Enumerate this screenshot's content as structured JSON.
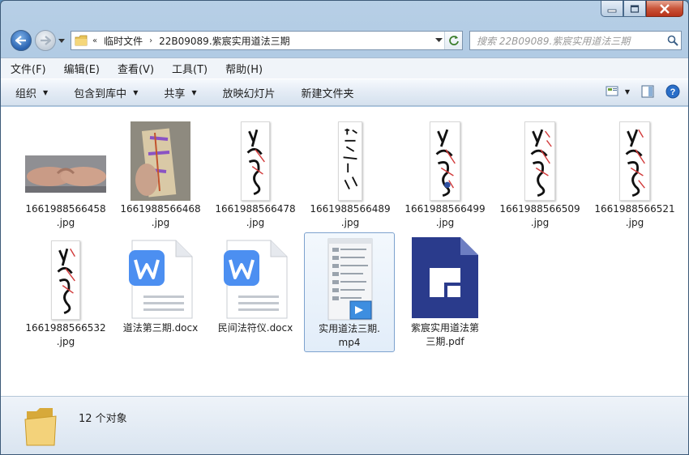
{
  "window": {
    "buttons": {
      "minimize": "minimize",
      "maximize": "maximize",
      "close": "close"
    }
  },
  "address": {
    "crumbs": [
      "«",
      "临时文件",
      "›",
      "22B09089.紫宸实用道法三期"
    ]
  },
  "search": {
    "placeholder": "搜索 22B09089.紫宸实用道法三期"
  },
  "menu": [
    "文件(F)",
    "编辑(E)",
    "查看(V)",
    "工具(T)",
    "帮助(H)"
  ],
  "toolbar": {
    "organize": "组织",
    "include_library": "包含到库中",
    "share": "共享",
    "slideshow": "放映幻灯片",
    "new_folder": "新建文件夹"
  },
  "files": [
    {
      "name_line1": "1661988566458",
      "name_line2": ".jpg",
      "kind": "photo-hands"
    },
    {
      "name_line1": "1661988566468",
      "name_line2": ".jpg",
      "kind": "photo-paper"
    },
    {
      "name_line1": "1661988566478",
      "name_line2": ".jpg",
      "kind": "talisman"
    },
    {
      "name_line1": "1661988566489",
      "name_line2": ".jpg",
      "kind": "talisman-text"
    },
    {
      "name_line1": "1661988566499",
      "name_line2": ".jpg",
      "kind": "talisman"
    },
    {
      "name_line1": "1661988566509",
      "name_line2": ".jpg",
      "kind": "talisman"
    },
    {
      "name_line1": "1661988566521",
      "name_line2": ".jpg",
      "kind": "talisman"
    },
    {
      "name_line1": "1661988566532",
      "name_line2": ".jpg",
      "kind": "talisman"
    },
    {
      "name_line1": "道法第三期.docx",
      "name_line2": "",
      "kind": "docx"
    },
    {
      "name_line1": "民间法符仪.docx",
      "name_line2": "",
      "kind": "docx"
    },
    {
      "name_line1": "实用道法三期.",
      "name_line2": "mp4",
      "kind": "mp4",
      "selected": true
    },
    {
      "name_line1": "紫宸实用道法第",
      "name_line2": "三期.pdf",
      "kind": "pdf"
    }
  ],
  "status": {
    "count": "12 个对象"
  },
  "colors": {
    "word_blue": "#4c8ff1",
    "pdf_navy": "#2a3b8c",
    "selection": "#7da2ce"
  }
}
